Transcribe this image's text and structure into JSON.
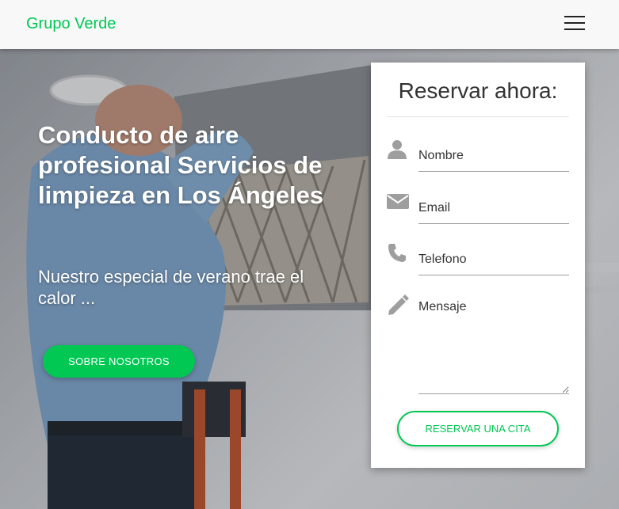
{
  "brand": {
    "name": "Grupo Verde",
    "accent_color": "#00c853"
  },
  "nav": {
    "menu_icon": "hamburger-menu-icon"
  },
  "hero": {
    "headline": "Conducto de aire profesional Servicios de limpieza en Los Ángeles",
    "subtitle": "Nuestro especial de verano trae el calor ...",
    "about_button": "SOBRE NOSOTROS"
  },
  "booking": {
    "title": "Reservar ahora:",
    "fields": {
      "name": {
        "placeholder": "Nombre",
        "value": "",
        "icon": "user-icon"
      },
      "email": {
        "placeholder": "Email",
        "value": "",
        "icon": "envelope-icon"
      },
      "phone": {
        "placeholder": "Telefono",
        "value": "",
        "icon": "phone-icon"
      },
      "message": {
        "placeholder": "Mensaje",
        "value": "",
        "icon": "pencil-icon"
      }
    },
    "submit": "RESERVAR UNA CITA"
  }
}
